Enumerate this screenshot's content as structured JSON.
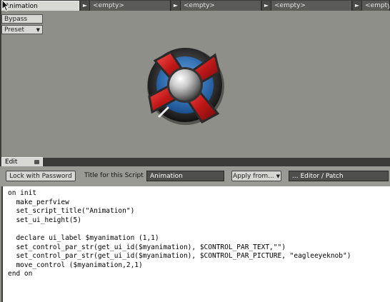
{
  "tabs": {
    "active": "Animation",
    "slots": [
      "<empty>",
      "<empty>",
      "<empty>",
      "<empty>"
    ]
  },
  "side_buttons": {
    "bypass": "Bypass",
    "preset": "Preset"
  },
  "performance_view": {
    "knob_icon": "eagleeyeknob"
  },
  "edit_tab": {
    "label": "Edit"
  },
  "controls": {
    "lock_password": "Lock with Password",
    "title_label": "Title for this Script",
    "title_value": "Animation",
    "apply_from": "Apply from...",
    "editor_patch": "... Editor / Patch"
  },
  "code_lines": [
    "on init",
    "  make_perfview",
    "  set_script_title(\"Animation\")",
    "  set_ui_height(5)",
    "",
    "  declare ui_label $myanimation (1,1)",
    "  set_control_par_str(get_ui_id($myanimation), $CONTROL_PAR_TEXT,\"\")",
    "  set_control_par_str(get_ui_id($myanimation), $CONTROL_PAR_PICTURE, \"eagleeyeknob\")",
    "  move_control ($myanimation,2,1)",
    "end on"
  ],
  "colors": {
    "background": "#8f8f89",
    "frame": "#3b3b39",
    "knob_red": "#c01818",
    "knob_blue": "#2a6fb8"
  }
}
